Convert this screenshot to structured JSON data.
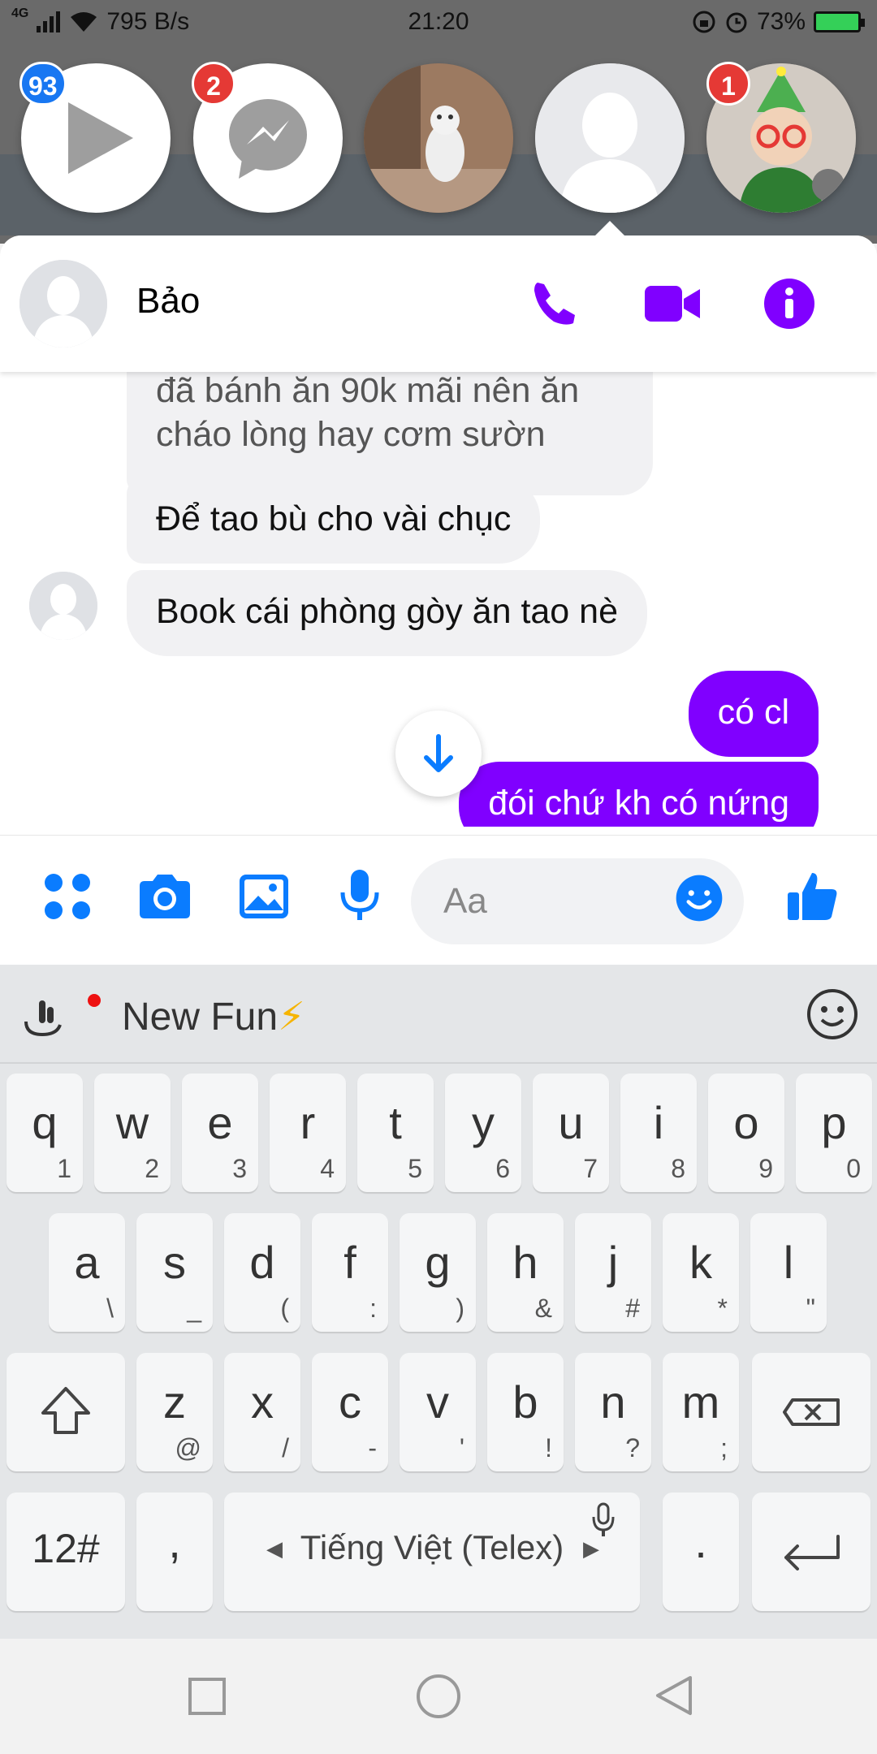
{
  "status_bar": {
    "network_label": "4G",
    "net_speed": "795 B/s",
    "time": "21:20",
    "battery_percent": "73%"
  },
  "chat_heads": [
    {
      "name": "video-head",
      "badge": "93",
      "badge_color": "#1877f2"
    },
    {
      "name": "messenger-head",
      "badge": "2",
      "badge_color": "#e53935"
    },
    {
      "name": "cat-photo-head",
      "badge": ""
    },
    {
      "name": "bao-head",
      "badge": ""
    },
    {
      "name": "christmas-head",
      "badge": "1",
      "badge_color": "#e53935"
    }
  ],
  "conversation": {
    "contact_name": "Bảo",
    "accent_color": "#8000ff",
    "messages": [
      {
        "from": "them",
        "text": "đã bánh ăn 90k mãi nên ăn"
      },
      {
        "from": "them",
        "text": "cháo lòng hay cơm sườn"
      },
      {
        "from": "them",
        "text": "Để tao bù cho vài chục"
      },
      {
        "from": "them",
        "text": "Book cái phòng gòy ăn tao nè"
      },
      {
        "from": "me",
        "text": "có cl"
      },
      {
        "from": "me",
        "text": "đói chứ kh có nứng"
      }
    ]
  },
  "composer": {
    "placeholder": "Aa",
    "icons": [
      "apps-icon",
      "camera-icon",
      "gallery-icon",
      "mic-icon",
      "emoji-icon",
      "like-icon"
    ],
    "icon_color": "#0a7cff"
  },
  "keyboard": {
    "toolbar_label": "New Fun",
    "toolbar_emoji": "⚡",
    "row1": [
      {
        "k": "q",
        "s": "1"
      },
      {
        "k": "w",
        "s": "2"
      },
      {
        "k": "e",
        "s": "3"
      },
      {
        "k": "r",
        "s": "4"
      },
      {
        "k": "t",
        "s": "5"
      },
      {
        "k": "y",
        "s": "6"
      },
      {
        "k": "u",
        "s": "7"
      },
      {
        "k": "i",
        "s": "8"
      },
      {
        "k": "o",
        "s": "9"
      },
      {
        "k": "p",
        "s": "0"
      }
    ],
    "row2": [
      {
        "k": "a",
        "s": "\\"
      },
      {
        "k": "s",
        "s": "_"
      },
      {
        "k": "d",
        "s": "("
      },
      {
        "k": "f",
        "s": ":"
      },
      {
        "k": "g",
        "s": ")"
      },
      {
        "k": "h",
        "s": "&"
      },
      {
        "k": "j",
        "s": "#"
      },
      {
        "k": "k",
        "s": "*"
      },
      {
        "k": "l",
        "s": "\""
      }
    ],
    "row3": [
      {
        "k": "z",
        "s": "@"
      },
      {
        "k": "x",
        "s": "/"
      },
      {
        "k": "c",
        "s": "-"
      },
      {
        "k": "v",
        "s": "'"
      },
      {
        "k": "b",
        "s": "!"
      },
      {
        "k": "n",
        "s": "?"
      },
      {
        "k": "m",
        "s": ";"
      }
    ],
    "numbers_key": "12#",
    "comma_key": ",",
    "space_label": "Tiếng Việt (Telex)",
    "period_key": "."
  }
}
